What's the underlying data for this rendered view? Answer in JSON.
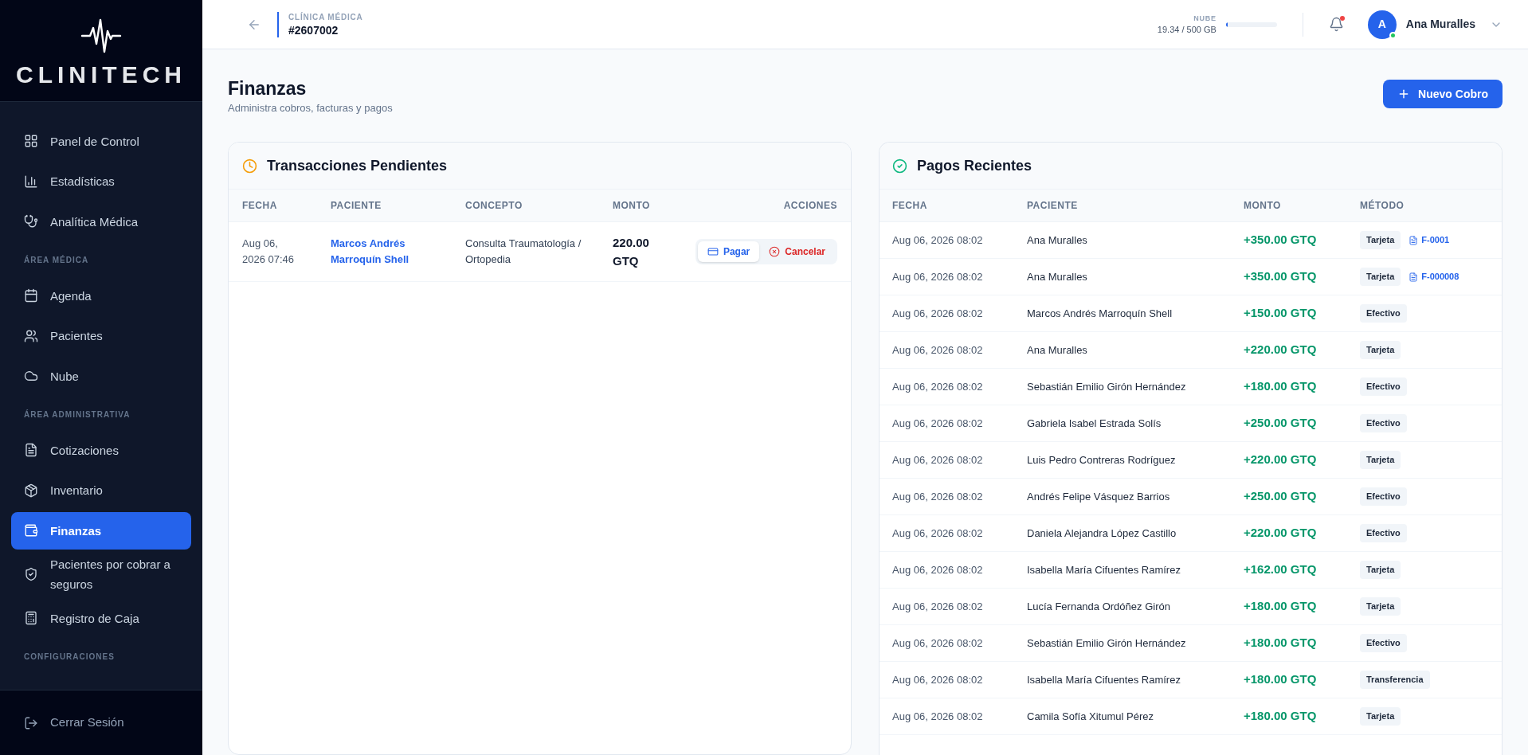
{
  "sidebar": {
    "logo": "CLINITECH",
    "sections": [
      {
        "items": [
          {
            "label": "Panel de Control",
            "selected": false
          },
          {
            "label": "Estadísticas",
            "selected": false
          },
          {
            "label": "Analítica Médica",
            "selected": false
          }
        ]
      },
      {
        "label": "ÁREA MÉDICA",
        "items": [
          {
            "label": "Agenda",
            "selected": false
          },
          {
            "label": "Pacientes",
            "selected": false
          },
          {
            "label": "Nube",
            "selected": false
          }
        ]
      },
      {
        "label": "ÁREA ADMINISTRATIVA",
        "items": [
          {
            "label": "Cotizaciones",
            "selected": false
          },
          {
            "label": "Inventario",
            "selected": false
          },
          {
            "label": "Finanzas",
            "selected": true
          },
          {
            "label": "Pacientes por cobrar a seguros",
            "selected": false
          },
          {
            "label": "Registro de Caja",
            "selected": false
          }
        ]
      },
      {
        "label": "CONFIGURACIONES"
      }
    ],
    "logout": "Cerrar Sesión"
  },
  "header": {
    "clinic_label": "CLÍNICA MÉDICA",
    "clinic_id": "#2607002",
    "storage_label": "NUBE",
    "storage_usage": "19.34 / 500 GB",
    "storage": {
      "level": 0.04
    },
    "has_notifications": true,
    "user": {
      "initial": "A",
      "name": "Ana Muralles",
      "online": true
    }
  },
  "page": {
    "title": "Finanzas",
    "subtitle": "Administra cobros, facturas y pagos",
    "new_button": "Nuevo Cobro"
  },
  "pending": {
    "title": "Transacciones Pendientes",
    "columns": [
      "FECHA",
      "PACIENTE",
      "CONCEPTO",
      "MONTO",
      "ACCIONES"
    ],
    "rows": [
      {
        "date": "Aug 06, 2026 07:46",
        "patient": "Marcos Andrés Marroquín Shell",
        "concept": "Consulta Traumatología / Ortopedia",
        "amount": "220.00 GTQ",
        "pay": "Pagar",
        "cancel": "Cancelar"
      }
    ]
  },
  "recent": {
    "title": "Pagos Recientes",
    "columns": [
      "FECHA",
      "PACIENTE",
      "MONTO",
      "MÉTODO"
    ],
    "rows": [
      {
        "date": "Aug 06, 2026 08:02",
        "patient": "Ana Muralles",
        "amount": "+350.00 GTQ",
        "method": "Tarjeta",
        "invoice": "F-0001"
      },
      {
        "date": "Aug 06, 2026 08:02",
        "patient": "Ana Muralles",
        "amount": "+350.00 GTQ",
        "method": "Tarjeta",
        "invoice": "F-000008"
      },
      {
        "date": "Aug 06, 2026 08:02",
        "patient": "Marcos Andrés Marroquín Shell",
        "amount": "+150.00 GTQ",
        "method": "Efectivo"
      },
      {
        "date": "Aug 06, 2026 08:02",
        "patient": "Ana Muralles",
        "amount": "+220.00 GTQ",
        "method": "Tarjeta"
      },
      {
        "date": "Aug 06, 2026 08:02",
        "patient": "Sebastián Emilio Girón Hernández",
        "amount": "+180.00 GTQ",
        "method": "Efectivo"
      },
      {
        "date": "Aug 06, 2026 08:02",
        "patient": "Gabriela Isabel Estrada Solís",
        "amount": "+250.00 GTQ",
        "method": "Efectivo"
      },
      {
        "date": "Aug 06, 2026 08:02",
        "patient": "Luis Pedro Contreras Rodríguez",
        "amount": "+220.00 GTQ",
        "method": "Tarjeta"
      },
      {
        "date": "Aug 06, 2026 08:02",
        "patient": "Andrés Felipe Vásquez Barrios",
        "amount": "+250.00 GTQ",
        "method": "Efectivo"
      },
      {
        "date": "Aug 06, 2026 08:02",
        "patient": "Daniela Alejandra López Castillo",
        "amount": "+220.00 GTQ",
        "method": "Efectivo"
      },
      {
        "date": "Aug 06, 2026 08:02",
        "patient": "Isabella María Cifuentes Ramírez",
        "amount": "+162.00 GTQ",
        "method": "Tarjeta"
      },
      {
        "date": "Aug 06, 2026 08:02",
        "patient": "Lucía Fernanda Ordóñez Girón",
        "amount": "+180.00 GTQ",
        "method": "Tarjeta"
      },
      {
        "date": "Aug 06, 2026 08:02",
        "patient": "Sebastián Emilio Girón Hernández",
        "amount": "+180.00 GTQ",
        "method": "Efectivo"
      },
      {
        "date": "Aug 06, 2026 08:02",
        "patient": "Isabella María Cifuentes Ramírez",
        "amount": "+180.00 GTQ",
        "method": "Transferencia"
      },
      {
        "date": "Aug 06, 2026 08:02",
        "patient": "Camila Sofía Xitumul Pérez",
        "amount": "+180.00 GTQ",
        "method": "Tarjeta"
      }
    ]
  }
}
